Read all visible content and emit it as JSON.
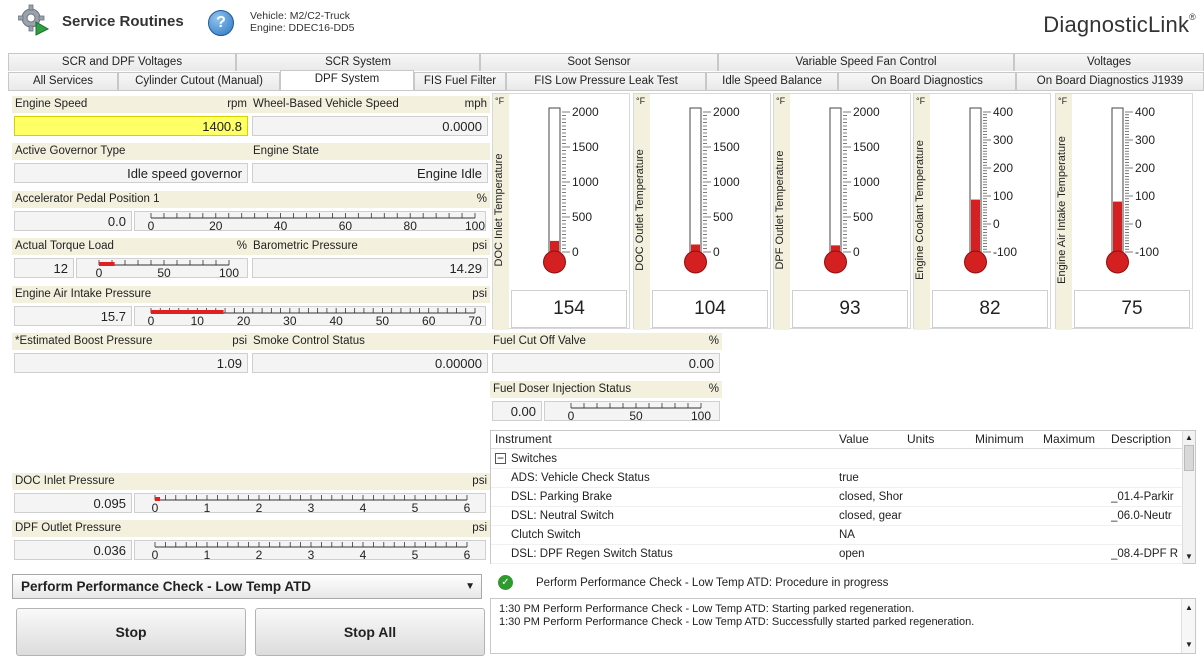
{
  "header": {
    "title": "Service Routines",
    "help": "?",
    "vehicle": "Vehicle: M2/C2-Truck",
    "engine": "Engine: DDEC16-DD5",
    "brand_main": "DiagnosticLink",
    "brand_tm": "®"
  },
  "tabs_row1": [
    "SCR and DPF Voltages",
    "SCR System",
    "Soot Sensor",
    "Variable Speed Fan Control",
    "Voltages"
  ],
  "tabs_row2": [
    "All Services",
    "Cylinder Cutout (Manual)",
    "DPF System",
    "FIS Fuel Filter",
    "FIS Low Pressure Leak Test",
    "Idle Speed Balance",
    "On Board Diagnostics",
    "On Board Diagnostics J1939"
  ],
  "active_tab": "DPF System",
  "params": {
    "engine_speed": {
      "label": "Engine Speed",
      "unit": "rpm",
      "value": "1400.8"
    },
    "wheel_speed": {
      "label": "Wheel-Based Vehicle Speed",
      "unit": "mph",
      "value": "0.0000"
    },
    "governor": {
      "label": "Active Governor Type",
      "value": "Idle speed governor"
    },
    "engine_state": {
      "label": "Engine State",
      "value": "Engine Idle"
    },
    "accel": {
      "label": "Accelerator Pedal Position 1",
      "unit": "%",
      "value": "0.0",
      "ticks": [
        "0",
        "20",
        "40",
        "60",
        "80",
        "100"
      ]
    },
    "torque": {
      "label": "Actual Torque Load",
      "unit": "%",
      "value": "12",
      "ticks": [
        "0",
        "50",
        "100"
      ]
    },
    "baro": {
      "label": "Barometric Pressure",
      "unit": "psi",
      "value": "14.29"
    },
    "air_intake_press": {
      "label": "Engine Air Intake Pressure",
      "unit": "psi",
      "value": "15.7",
      "ticks": [
        "0",
        "10",
        "20",
        "30",
        "40",
        "50",
        "60",
        "70"
      ]
    },
    "boost": {
      "label": "*Estimated Boost Pressure",
      "unit": "psi",
      "value": "1.09"
    },
    "smoke": {
      "label": "Smoke Control Status",
      "value": "0.00000"
    },
    "fuel_cutoff": {
      "label": "Fuel Cut Off Valve",
      "unit": "%",
      "value": "0.00"
    },
    "doser": {
      "label": "Fuel Doser Injection Status",
      "unit": "%",
      "value": "0.00",
      "ticks": [
        "0",
        "50",
        "100"
      ]
    },
    "doc_inlet_press": {
      "label": "DOC Inlet Pressure",
      "unit": "psi",
      "value": "0.095",
      "ticks": [
        "0",
        "1",
        "2",
        "3",
        "4",
        "5",
        "6"
      ]
    },
    "dpf_outlet_press": {
      "label": "DPF Outlet Pressure",
      "unit": "psi",
      "value": "0.036",
      "ticks": [
        "0",
        "1",
        "2",
        "3",
        "4",
        "5",
        "6"
      ]
    }
  },
  "thermometers": [
    {
      "label": "DOC Inlet Temperature",
      "unit": "°F",
      "value": "154",
      "ticks": [
        "2000",
        "1500",
        "1000",
        "500",
        "0"
      ]
    },
    {
      "label": "DOC Outlet Temperature",
      "unit": "°F",
      "value": "104",
      "ticks": [
        "2000",
        "1500",
        "1000",
        "500",
        "0"
      ]
    },
    {
      "label": "DPF Outlet Temperature",
      "unit": "°F",
      "value": "93",
      "ticks": [
        "2000",
        "1500",
        "1000",
        "500",
        "0"
      ]
    },
    {
      "label": "Engine Coolant Temperature",
      "unit": "°F",
      "value": "82",
      "ticks": [
        "400",
        "300",
        "200",
        "100",
        "0",
        "-100"
      ]
    },
    {
      "label": "Engine Air Intake Temperature",
      "unit": "°F",
      "value": "75",
      "ticks": [
        "400",
        "300",
        "200",
        "100",
        "0",
        "-100"
      ]
    }
  ],
  "instrument_table": {
    "columns": [
      "Instrument",
      "Value",
      "Units",
      "Minimum",
      "Maximum",
      "Description"
    ],
    "group": "Switches",
    "rows": [
      {
        "instrument": "ADS: Vehicle Check Status",
        "value": "true",
        "desc": ""
      },
      {
        "instrument": "DSL: Parking Brake",
        "value": "closed, Shor",
        "desc": "_01.4-Parkir"
      },
      {
        "instrument": "DSL: Neutral Switch",
        "value": "closed, gear",
        "desc": "_06.0-Neutr"
      },
      {
        "instrument": "Clutch Switch",
        "value": "NA",
        "desc": ""
      },
      {
        "instrument": "DSL: DPF Regen Switch Status",
        "value": "open",
        "desc": "_08.4-DPF R"
      }
    ]
  },
  "procedure": {
    "selected": "Perform Performance Check - Low Temp ATD",
    "stop": "Stop",
    "stop_all": "Stop All",
    "status": "Perform Performance Check - Low Temp ATD: Procedure in progress",
    "log": [
      "1:30 PM Perform Performance Check - Low Temp ATD: Starting parked regeneration.",
      "1:30 PM Perform Performance Check - Low Temp ATD: Successfully started parked regeneration."
    ]
  }
}
